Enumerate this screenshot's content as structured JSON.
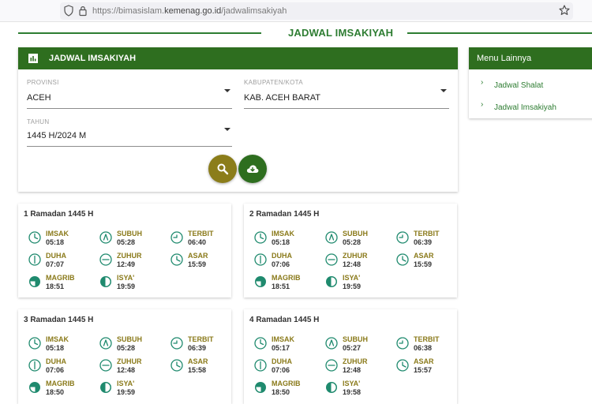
{
  "browser": {
    "url_prefix": "https://bimasislam.",
    "url_domain": "kemenag.go.id",
    "url_path": "/jadwalimsakiyah"
  },
  "page": {
    "heading": "JADWAL IMSAKIYAH"
  },
  "form_card": {
    "header_title": "JADWAL IMSAKIYAH",
    "provinsi_label": "PROVINSI",
    "provinsi_value": "ACEH",
    "kabupaten_label": "KABUPATEN/KOTA",
    "kabupaten_value": "KAB. ACEH BARAT",
    "tahun_label": "TAHUN",
    "tahun_value": "1445 H/2024 M"
  },
  "side_menu": {
    "title": "Menu Lainnya",
    "items": [
      {
        "label": "Jadwal Shalat"
      },
      {
        "label": "Jadwal Imsakiyah"
      }
    ]
  },
  "days": [
    {
      "title": "1 Ramadan 1445 H",
      "times": [
        {
          "name": "IMSAK",
          "time": "05:18",
          "icon": "clock-icon"
        },
        {
          "name": "SUBUH",
          "time": "05:28",
          "icon": "clock-icon"
        },
        {
          "name": "TERBIT",
          "time": "06:40",
          "icon": "clock-icon"
        },
        {
          "name": "DUHA",
          "time": "07:07",
          "icon": "clock-icon"
        },
        {
          "name": "ZUHUR",
          "time": "12:49",
          "icon": "clock-icon"
        },
        {
          "name": "ASAR",
          "time": "15:59",
          "icon": "clock-icon"
        },
        {
          "name": "MAGRIB",
          "time": "18:51",
          "icon": "clock-filled-icon"
        },
        {
          "name": "ISYA'",
          "time": "19:59",
          "icon": "clock-filled-icon"
        }
      ]
    },
    {
      "title": "2 Ramadan 1445 H",
      "times": [
        {
          "name": "IMSAK",
          "time": "05:18",
          "icon": "clock-icon"
        },
        {
          "name": "SUBUH",
          "time": "05:28",
          "icon": "clock-icon"
        },
        {
          "name": "TERBIT",
          "time": "06:39",
          "icon": "clock-icon"
        },
        {
          "name": "DUHA",
          "time": "07:06",
          "icon": "clock-icon"
        },
        {
          "name": "ZUHUR",
          "time": "12:48",
          "icon": "clock-icon"
        },
        {
          "name": "ASAR",
          "time": "15:59",
          "icon": "clock-icon"
        },
        {
          "name": "MAGRIB",
          "time": "18:51",
          "icon": "clock-filled-icon"
        },
        {
          "name": "ISYA'",
          "time": "19:59",
          "icon": "clock-filled-icon"
        }
      ]
    },
    {
      "title": "3 Ramadan 1445 H",
      "times": [
        {
          "name": "IMSAK",
          "time": "05:18",
          "icon": "clock-icon"
        },
        {
          "name": "SUBUH",
          "time": "05:28",
          "icon": "clock-icon"
        },
        {
          "name": "TERBIT",
          "time": "06:39",
          "icon": "clock-icon"
        },
        {
          "name": "DUHA",
          "time": "07:06",
          "icon": "clock-icon"
        },
        {
          "name": "ZUHUR",
          "time": "12:48",
          "icon": "clock-icon"
        },
        {
          "name": "ASAR",
          "time": "15:58",
          "icon": "clock-icon"
        },
        {
          "name": "MAGRIB",
          "time": "18:50",
          "icon": "clock-filled-icon"
        },
        {
          "name": "ISYA'",
          "time": "19:59",
          "icon": "clock-filled-icon"
        }
      ]
    },
    {
      "title": "4 Ramadan 1445 H",
      "times": [
        {
          "name": "IMSAK",
          "time": "05:17",
          "icon": "clock-icon"
        },
        {
          "name": "SUBUH",
          "time": "05:27",
          "icon": "clock-icon"
        },
        {
          "name": "TERBIT",
          "time": "06:38",
          "icon": "clock-icon"
        },
        {
          "name": "DUHA",
          "time": "07:06",
          "icon": "clock-icon"
        },
        {
          "name": "ZUHUR",
          "time": "12:48",
          "icon": "clock-icon"
        },
        {
          "name": "ASAR",
          "time": "15:57",
          "icon": "clock-icon"
        },
        {
          "name": "MAGRIB",
          "time": "18:50",
          "icon": "clock-filled-icon"
        },
        {
          "name": "ISYA'",
          "time": "19:58",
          "icon": "clock-filled-icon"
        }
      ]
    }
  ],
  "colors": {
    "brand_green": "#2e6e1f",
    "accent_green": "#2e7d32",
    "search_button": "#8b7d1a",
    "download_button": "#2e6e1f",
    "prayer_name": "#8a7a1a",
    "icon_teal": "#1f8a6e"
  }
}
